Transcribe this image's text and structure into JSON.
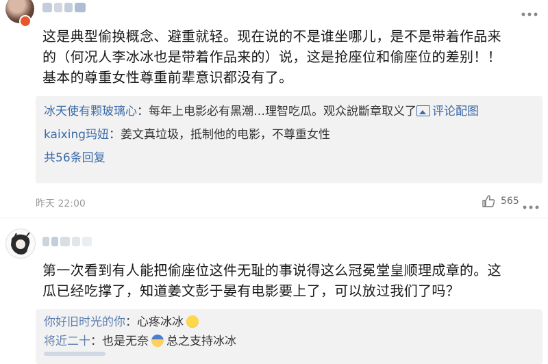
{
  "comment1": {
    "text_lines": [
      "这是典型偷换概念、避重就轻。现在说的不是谁坐哪儿，是不是带着作品来",
      "的（何况人李冰冰也是带着作品来的）说，这是抢座位和偷座位的差别！！",
      "基本的尊重女性尊重前辈意识都没有了。"
    ],
    "replies": [
      {
        "name": "冰天使有颗玻璃心",
        "sep": "：",
        "text": "每年上电影必有黑潮…理智吃瓜。观众說斷章取义了",
        "link": "评论配图"
      },
      {
        "name": "kaixing玛妞",
        "sep": "：",
        "text": "姜文真垃圾，抵制他的电影，不尊重女性"
      }
    ],
    "more_replies": "共56条回复",
    "time": "昨天 22:00",
    "likes": "565"
  },
  "comment2": {
    "text_lines": [
      "第一次看到有人能把偷座位这件无耻的事说得这么冠冕堂皇顺理成章的。这",
      "瓜已经吃撑了，知道姜文彭于晏有电影要上了，可以放过我们了吗？"
    ],
    "replies": [
      {
        "name": "你好旧时光的你",
        "sep": "：",
        "text": "心疼冰冰"
      },
      {
        "name": "将近二十",
        "sep": "：",
        "text": "也是无奈",
        "text2": "总之支持冰冰"
      }
    ]
  },
  "icons": {
    "image": "image-icon",
    "like": "thumbs-up-icon",
    "more": "more-dots-icon",
    "emoji1": "grinning-emoji-icon",
    "emoji2": "bowing-emoji-icon"
  },
  "colors": {
    "link": "#3b6aa8",
    "reply_bg": "#f2f2f2",
    "meta": "#999999"
  }
}
